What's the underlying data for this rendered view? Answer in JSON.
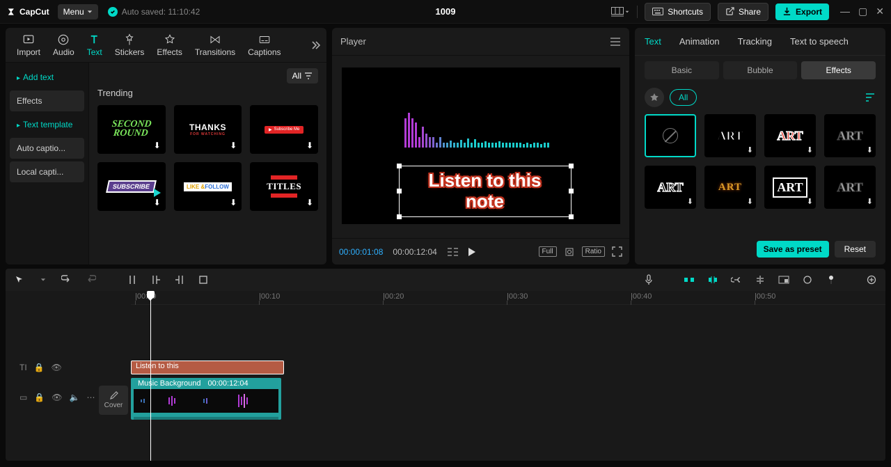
{
  "app": {
    "name": "CapCut",
    "project_title": "1009"
  },
  "topbar": {
    "menu_label": "Menu",
    "autosave_prefix": "Auto saved: ",
    "autosave_time": "11:10:42",
    "shortcuts_label": "Shortcuts",
    "share_label": "Share",
    "export_label": "Export"
  },
  "left_panel": {
    "tabs": {
      "import": "Import",
      "audio": "Audio",
      "text": "Text",
      "stickers": "Stickers",
      "effects": "Effects",
      "transitions": "Transitions",
      "captions": "Captions"
    },
    "sidebar": {
      "add_text": "Add text",
      "effects": "Effects",
      "text_template": "Text template",
      "auto_captions": "Auto captio...",
      "local_captions": "Local capti..."
    },
    "filter_label": "All",
    "trending_label": "Trending",
    "templates": {
      "second_line1": "SECOND",
      "second_line2": "ROUND",
      "thanks_main": "THANKS",
      "thanks_sub": "FOR WATCHING",
      "subscribe_me": "Subscribe Me",
      "subscribe": "SUBSCRIBE",
      "like_follow_like": "LIKE ",
      "like_follow_amp": "&",
      "like_follow_follow": "FOLLOW",
      "titles": "TITLES"
    }
  },
  "player": {
    "title": "Player",
    "time_current": "00:00:01:08",
    "time_total": "00:00:12:04",
    "overlay_line1": "Listen to this",
    "overlay_line2": "note",
    "full_label": "Full",
    "ratio_label": "Ratio"
  },
  "props": {
    "tabs": {
      "text": "Text",
      "animation": "Animation",
      "tracking": "Tracking",
      "tts": "Text to speech"
    },
    "subtabs": {
      "basic": "Basic",
      "bubble": "Bubble",
      "effects": "Effects"
    },
    "all_label": "All",
    "art_label": "ART",
    "save_preset": "Save as preset",
    "reset": "Reset"
  },
  "timeline": {
    "ruler": {
      "t0": "00:00",
      "t1": "00:10",
      "t2": "00:20",
      "t3": "00:30",
      "t4": "00:40",
      "t5": "00:50"
    },
    "cover_label": "Cover",
    "text_clip_label": "Listen to this",
    "video_clip_name": "Music Background",
    "video_clip_dur": "00:00:12:04"
  }
}
